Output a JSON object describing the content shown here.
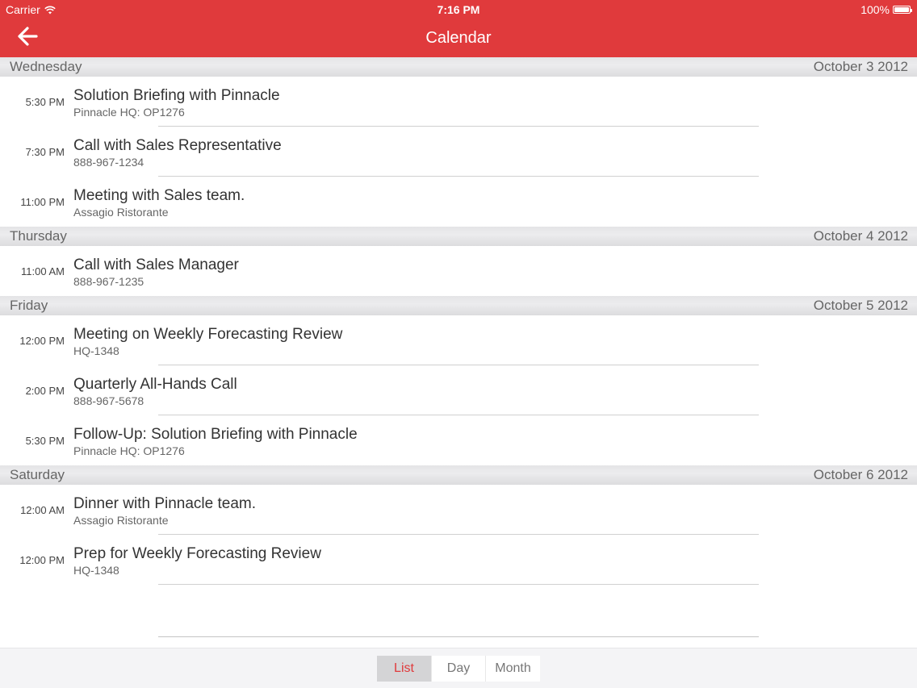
{
  "status": {
    "carrier": "Carrier",
    "time": "7:16 PM",
    "battery": "100%"
  },
  "nav": {
    "title": "Calendar",
    "back_icon": "arrow-left-icon"
  },
  "days": [
    {
      "day": "Wednesday",
      "date": "October 3 2012",
      "events": [
        {
          "time": "5:30 PM",
          "title": "Solution Briefing with Pinnacle",
          "subtitle": "Pinnacle HQ: OP1276"
        },
        {
          "time": "7:30 PM",
          "title": "Call with Sales Representative",
          "subtitle": "888-967-1234"
        },
        {
          "time": "11:00 PM",
          "title": "Meeting with Sales team.",
          "subtitle": "Assagio Ristorante"
        }
      ]
    },
    {
      "day": "Thursday",
      "date": "October 4 2012",
      "events": [
        {
          "time": "11:00 AM",
          "title": "Call with Sales Manager",
          "subtitle": "888-967-1235"
        }
      ]
    },
    {
      "day": "Friday",
      "date": "October 5 2012",
      "events": [
        {
          "time": "12:00 PM",
          "title": "Meeting on Weekly Forecasting Review",
          "subtitle": "HQ-1348"
        },
        {
          "time": "2:00 PM",
          "title": "Quarterly All-Hands Call",
          "subtitle": "888-967-5678"
        },
        {
          "time": "5:30 PM",
          "title": "Follow-Up: Solution Briefing with Pinnacle",
          "subtitle": "Pinnacle HQ: OP1276"
        }
      ]
    },
    {
      "day": "Saturday",
      "date": "October 6 2012",
      "events": [
        {
          "time": "12:00 AM",
          "title": "Dinner with Pinnacle team.",
          "subtitle": "Assagio Ristorante"
        },
        {
          "time": "12:00 PM",
          "title": "Prep for Weekly Forecasting Review",
          "subtitle": "HQ-1348"
        }
      ]
    }
  ],
  "view_switcher": {
    "list": "List",
    "day": "Day",
    "month": "Month",
    "selected": "List"
  },
  "colors": {
    "accent": "#e03a3c",
    "header_bg": "#e4e4e6"
  }
}
